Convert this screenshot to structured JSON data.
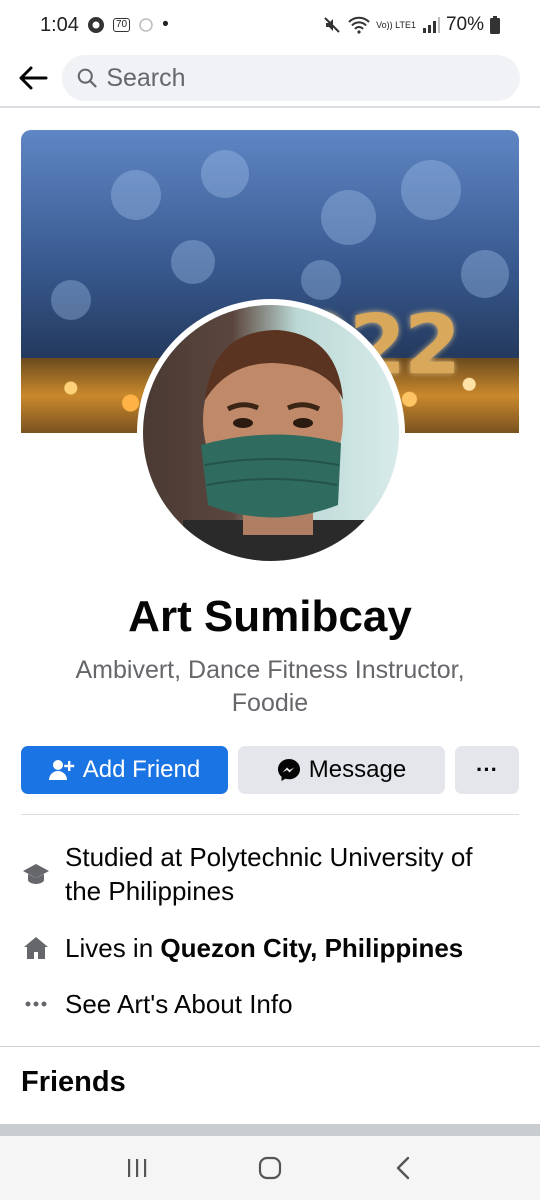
{
  "status_bar": {
    "time": "1:04",
    "badge": "70",
    "battery": "70%",
    "network": "Vo)) LTE1"
  },
  "header": {
    "search_placeholder": "Search"
  },
  "cover": {
    "year_text": "022"
  },
  "profile": {
    "name": "Art Sumibcay",
    "bio": "Ambivert, Dance Fitness Instructor, Foodie"
  },
  "actions": {
    "add_friend": "Add Friend",
    "message": "Message",
    "more": "···"
  },
  "info": {
    "studied": "Studied at Polytechnic University of the Philippines",
    "lives_prefix": "Lives in ",
    "lives_place": "Quezon City, Philippines",
    "about": "See Art's About Info"
  },
  "friends": {
    "title": "Friends"
  },
  "colors": {
    "primary": "#1b74e4",
    "secondary_button": "#e4e6eb",
    "muted_text": "#65676b"
  }
}
